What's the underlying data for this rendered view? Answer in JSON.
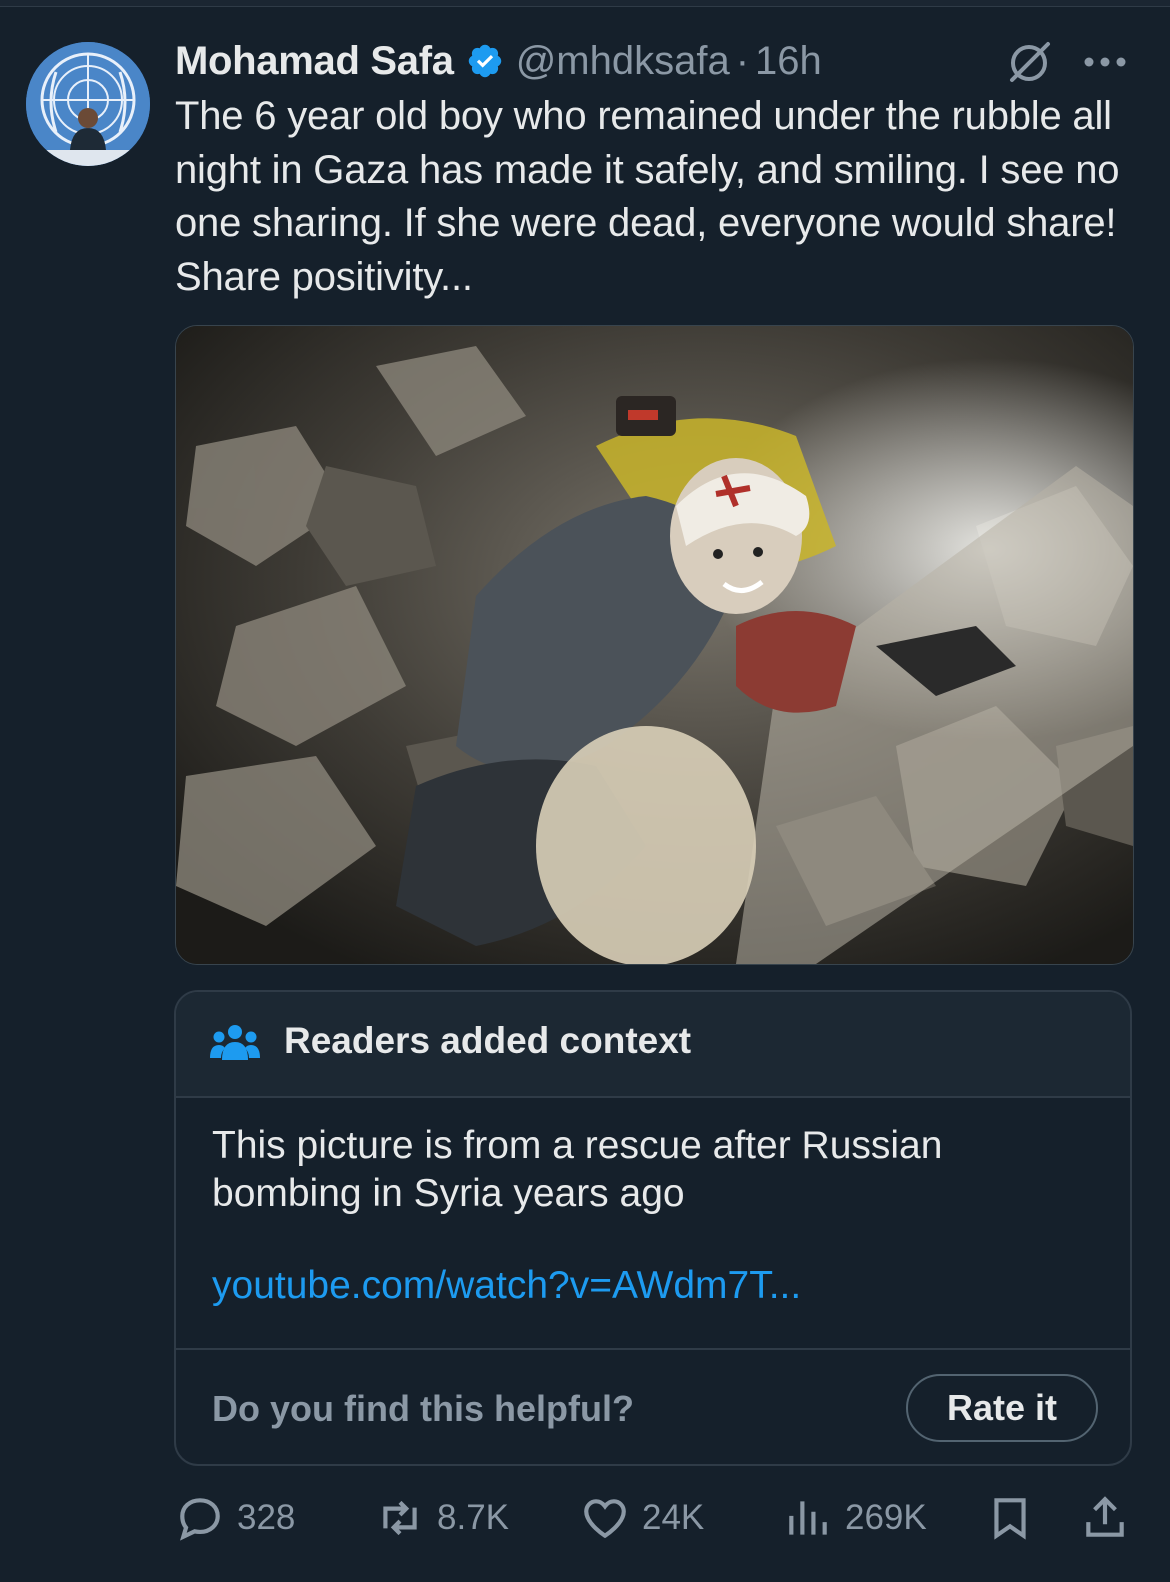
{
  "post": {
    "author_name": "Mohamad Safa",
    "handle": "@mhdksafa",
    "separator": "·",
    "time": "16h",
    "text": "The 6 year old boy who remained under the rubble all night in Gaza has made it safely, and smiling. I see no one sharing. If she were dead, everyone would share! Share positivity...",
    "verified": true,
    "avatar_icon": "un-emblem-avatar",
    "media_icon": "rescue-photo"
  },
  "community_note": {
    "title": "Readers added context",
    "body": "This picture is from a rescue after Russian bombing in Syria years ago",
    "link": "youtube.com/watch?v=AWdm7T...",
    "question": "Do you find this helpful?",
    "rate_label": "Rate it"
  },
  "actions": {
    "replies": "328",
    "reposts": "8.7K",
    "likes": "24K",
    "views": "269K"
  },
  "colors": {
    "background": "#15202b",
    "text": "#e7e9ea",
    "secondary": "#8b98a5",
    "accent": "#1d9bf0",
    "border": "#2f3b47"
  }
}
